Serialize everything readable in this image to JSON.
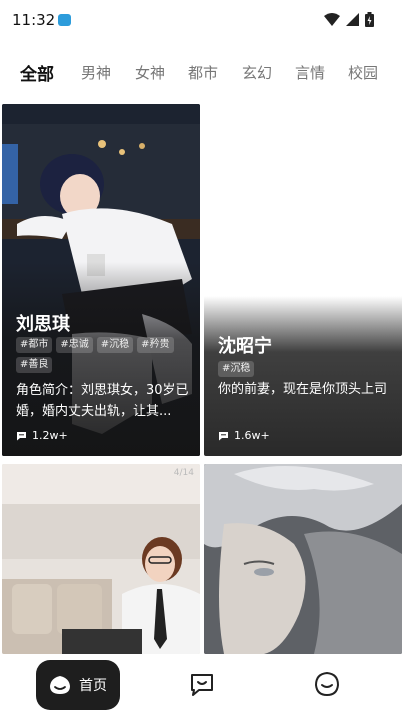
{
  "status_bar": {
    "time": "11:32"
  },
  "tabs": [
    {
      "label": "全部",
      "active": true
    },
    {
      "label": "男神"
    },
    {
      "label": "女神"
    },
    {
      "label": "都市"
    },
    {
      "label": "玄幻"
    },
    {
      "label": "言情"
    },
    {
      "label": "校园"
    }
  ],
  "cards": [
    {
      "name": "刘思琪",
      "tags": [
        "#都市",
        "#忠诚",
        "#沉稳",
        "#矜贵",
        "#善良"
      ],
      "description": "角色简介：刘思琪女，30岁已婚，婚内丈夫出轨，让其...",
      "count": "1.2w+"
    },
    {
      "name": "沈昭宁",
      "tags": [
        "#沉稳"
      ],
      "description": "你的前妻，现在是你顶头上司",
      "count": "1.6w+"
    },
    {
      "page_indicator": "4/14"
    }
  ],
  "bottom_nav": {
    "home_label": "首页"
  },
  "colors": {
    "accent_underline": "#d9ff5a",
    "nav_active_bg": "#1e1e1e"
  }
}
